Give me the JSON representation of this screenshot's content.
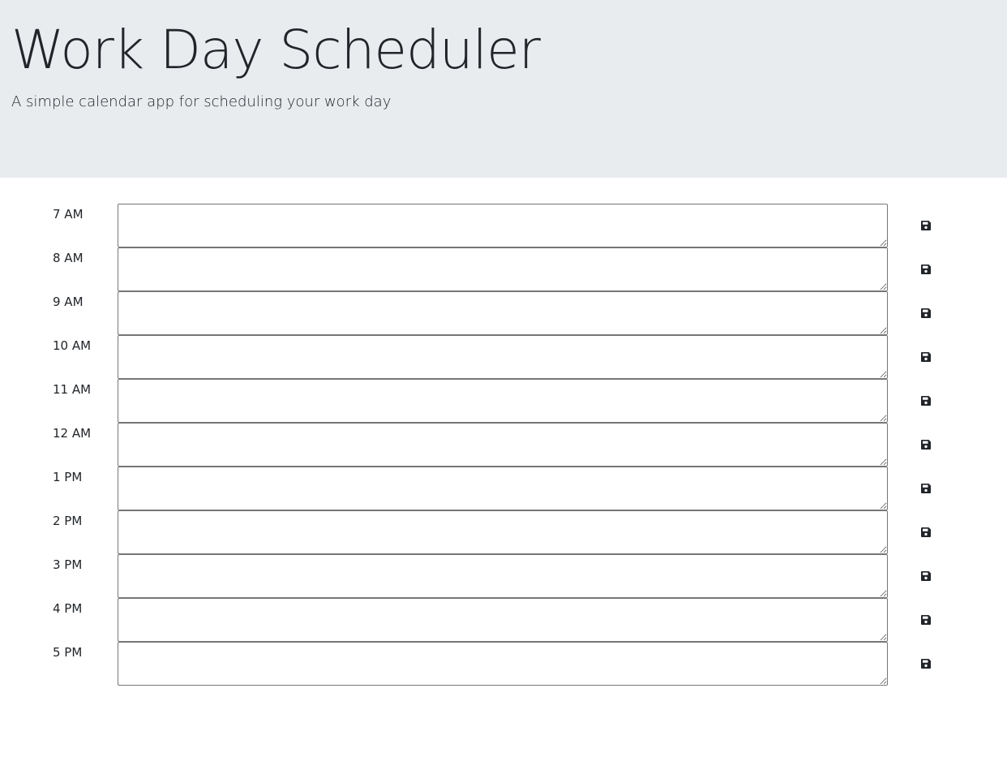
{
  "header": {
    "title": "Work Day Scheduler",
    "subtitle": "A simple calendar app for scheduling your work day"
  },
  "colors": {
    "header_background": "#e9ecef",
    "text": "#212529",
    "textarea_border": "#767676"
  },
  "schedule": {
    "rows": [
      {
        "hour": "7 AM",
        "entry": "",
        "save_icon": "floppy-disk-icon"
      },
      {
        "hour": "8 AM",
        "entry": "",
        "save_icon": "floppy-disk-icon"
      },
      {
        "hour": "9 AM",
        "entry": "",
        "save_icon": "floppy-disk-icon"
      },
      {
        "hour": "10 AM",
        "entry": "",
        "save_icon": "floppy-disk-icon"
      },
      {
        "hour": "11 AM",
        "entry": "",
        "save_icon": "floppy-disk-icon"
      },
      {
        "hour": "12 AM",
        "entry": "",
        "save_icon": "floppy-disk-icon"
      },
      {
        "hour": "1 PM",
        "entry": "",
        "save_icon": "floppy-disk-icon"
      },
      {
        "hour": "2 PM",
        "entry": "",
        "save_icon": "floppy-disk-icon"
      },
      {
        "hour": "3 PM",
        "entry": "",
        "save_icon": "floppy-disk-icon"
      },
      {
        "hour": "4 PM",
        "entry": "",
        "save_icon": "floppy-disk-icon"
      },
      {
        "hour": "5 PM",
        "entry": "",
        "save_icon": "floppy-disk-icon"
      }
    ]
  }
}
